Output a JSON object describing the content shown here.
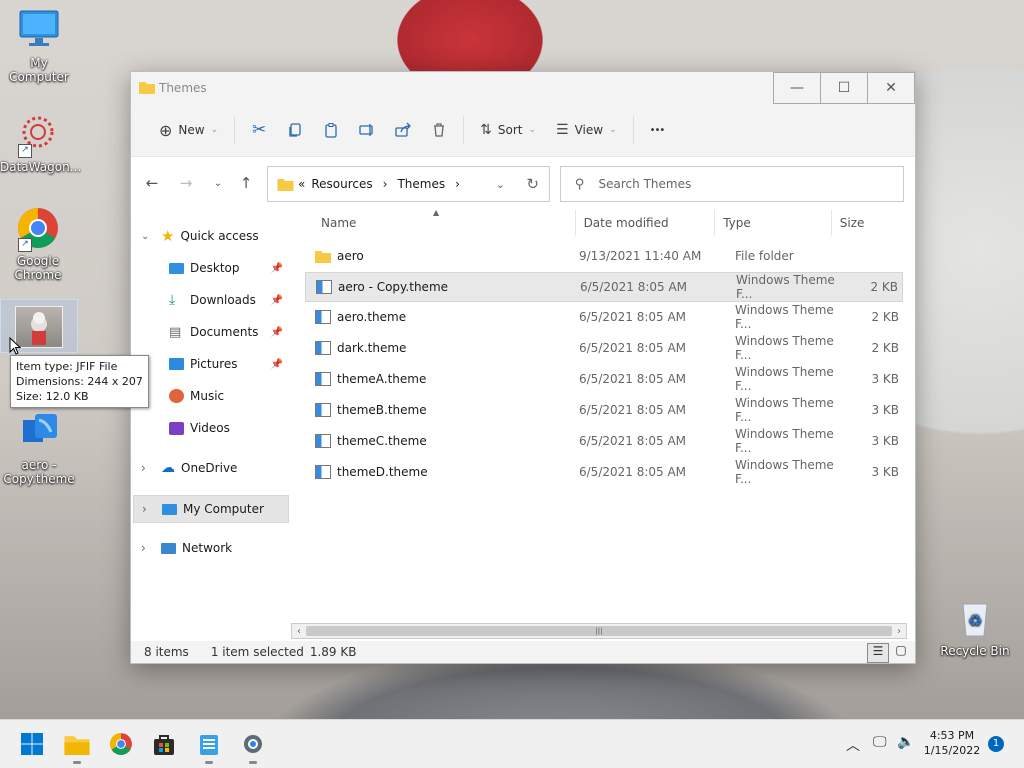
{
  "desktop": {
    "icons": [
      {
        "label": "My Computer"
      },
      {
        "label": "DataWagon..."
      },
      {
        "label": "Google Chrome"
      },
      {
        "label": "aero - Copy.theme"
      },
      {
        "label": "Recycle Bin"
      }
    ],
    "tooltip": {
      "line1": "Item type: JFIF File",
      "line2": "Dimensions: 244 x 207",
      "line3": "Size: 12.0 KB"
    }
  },
  "window": {
    "title": "Themes",
    "toolbar": {
      "new_label": "New",
      "sort_label": "Sort",
      "view_label": "View",
      "more_label": "•••"
    },
    "address": {
      "prefix": "«",
      "crumb1": "Resources",
      "crumb2": "Themes"
    },
    "search_placeholder": "Search Themes",
    "sidebar": {
      "quick_access": "Quick access",
      "items": [
        {
          "label": "Desktop"
        },
        {
          "label": "Downloads"
        },
        {
          "label": "Documents"
        },
        {
          "label": "Pictures"
        },
        {
          "label": "Music"
        },
        {
          "label": "Videos"
        }
      ],
      "onedrive": "OneDrive",
      "my_computer": "My Computer",
      "network": "Network"
    },
    "columns": {
      "name": "Name",
      "date": "Date modified",
      "type": "Type",
      "size": "Size"
    },
    "files": [
      {
        "name": "aero",
        "date": "9/13/2021 11:40 AM",
        "type": "File folder",
        "size": "",
        "kind": "folder"
      },
      {
        "name": "aero - Copy.theme",
        "date": "6/5/2021 8:05 AM",
        "type": "Windows Theme F...",
        "size": "2 KB",
        "kind": "theme"
      },
      {
        "name": "aero.theme",
        "date": "6/5/2021 8:05 AM",
        "type": "Windows Theme F...",
        "size": "2 KB",
        "kind": "theme"
      },
      {
        "name": "dark.theme",
        "date": "6/5/2021 8:05 AM",
        "type": "Windows Theme F...",
        "size": "2 KB",
        "kind": "theme"
      },
      {
        "name": "themeA.theme",
        "date": "6/5/2021 8:05 AM",
        "type": "Windows Theme F...",
        "size": "3 KB",
        "kind": "theme"
      },
      {
        "name": "themeB.theme",
        "date": "6/5/2021 8:05 AM",
        "type": "Windows Theme F...",
        "size": "3 KB",
        "kind": "theme"
      },
      {
        "name": "themeC.theme",
        "date": "6/5/2021 8:05 AM",
        "type": "Windows Theme F...",
        "size": "3 KB",
        "kind": "theme"
      },
      {
        "name": "themeD.theme",
        "date": "6/5/2021 8:05 AM",
        "type": "Windows Theme F...",
        "size": "3 KB",
        "kind": "theme"
      }
    ],
    "status": {
      "count": "8 items",
      "selected": "1 item selected",
      "size": "1.89 KB"
    }
  },
  "taskbar": {
    "time": "4:53 PM",
    "date": "1/15/2022",
    "notification_count": "1"
  },
  "colors": {
    "accent": "#0067c0",
    "folder": "#f7c945"
  }
}
